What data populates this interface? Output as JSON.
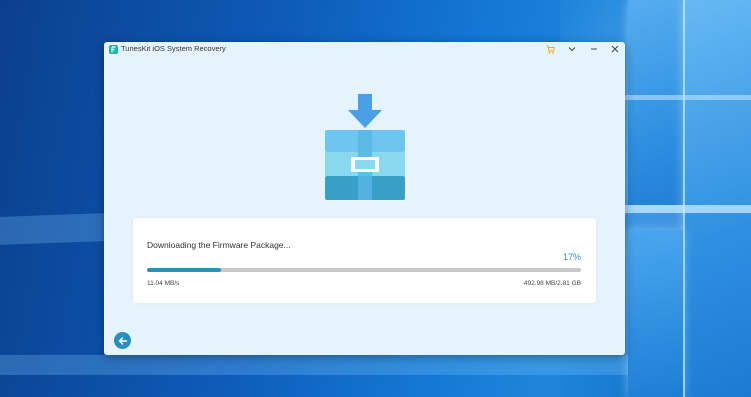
{
  "window": {
    "title": "TunesKit iOS System Recovery",
    "controls": {
      "cart_icon": "cart-icon",
      "menu_icon": "chevron-down-icon",
      "minimize_icon": "minimize-icon",
      "close_icon": "close-icon"
    }
  },
  "illustration": {
    "icon": "firmware-package-icon",
    "colors": {
      "arrow": "#4a9fe6",
      "box_top": "#6ec6f0",
      "box_middle": "#8ad8ef",
      "box_bottom": "#3a9fc8"
    }
  },
  "download": {
    "title": "Downloading the Firmware Package...",
    "percent_label": "17%",
    "progress_value": 0.17,
    "speed": "11.04 MB/s",
    "size": "492.98 MB/2.81 GB"
  },
  "footer": {
    "back_icon": "back-arrow-icon"
  },
  "colors": {
    "accent": "#2a8fbf",
    "window_bg": "#e4f3fc",
    "track": "#c9c9c9"
  }
}
